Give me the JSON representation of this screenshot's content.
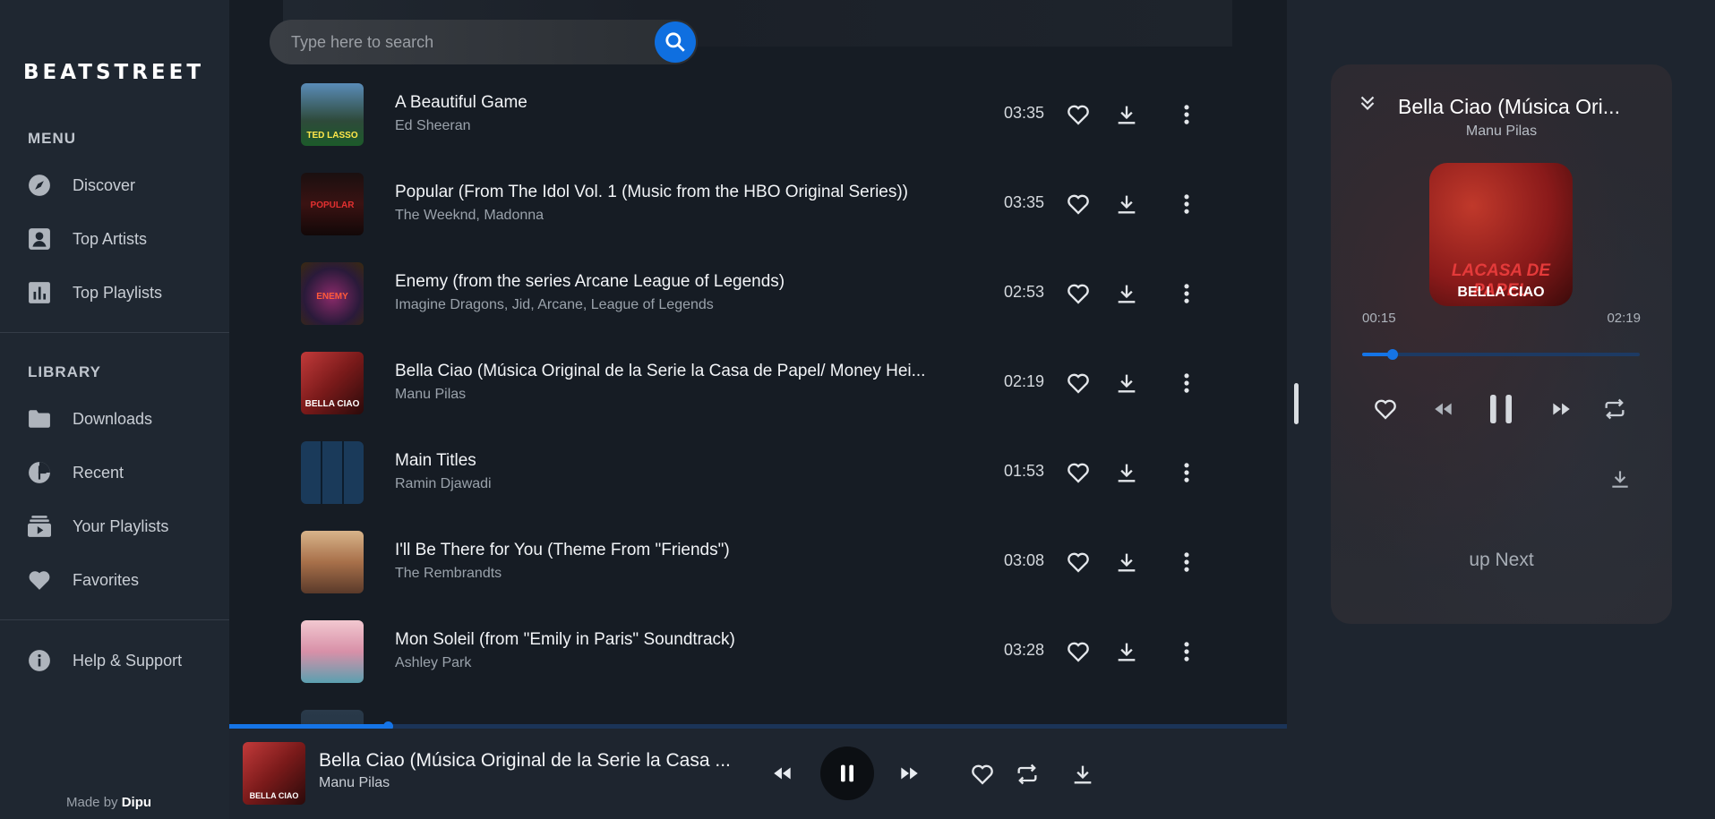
{
  "app": {
    "logo": "BEATSTREET",
    "made_by_prefix": "Made by",
    "made_by_name": "Dipu"
  },
  "sidebar": {
    "menu_title": "MENU",
    "menu": [
      {
        "label": "Discover",
        "icon": "compass-icon"
      },
      {
        "label": "Top Artists",
        "icon": "artist-icon"
      },
      {
        "label": "Top Playlists",
        "icon": "chart-icon"
      }
    ],
    "library_title": "LIBRARY",
    "library": [
      {
        "label": "Downloads",
        "icon": "folder-icon"
      },
      {
        "label": "Recent",
        "icon": "recent-icon"
      },
      {
        "label": "Your Playlists",
        "icon": "playlist-icon"
      },
      {
        "label": "Favorites",
        "icon": "heart-icon"
      }
    ],
    "help": {
      "label": "Help & Support",
      "icon": "info-icon"
    }
  },
  "search": {
    "placeholder": "Type here to search"
  },
  "songs": [
    {
      "title": "A Beautiful Game",
      "artist": "Ed Sheeran",
      "duration": "03:35"
    },
    {
      "title": "Popular (From The Idol Vol. 1 (Music from the HBO Original Series))",
      "artist": "The Weeknd, Madonna",
      "duration": "03:35"
    },
    {
      "title": "Enemy (from the series Arcane League of Legends)",
      "artist": "Imagine Dragons, Jid, Arcane, League of Legends",
      "duration": "02:53"
    },
    {
      "title": "Bella Ciao (Música Original de la Serie la Casa de Papel/ Money Hei...",
      "artist": "Manu Pilas",
      "duration": "02:19"
    },
    {
      "title": "Main Titles",
      "artist": "Ramin Djawadi",
      "duration": "01:53"
    },
    {
      "title": "I'll Be There for You (Theme From \"Friends\")",
      "artist": "The Rembrandts",
      "duration": "03:08"
    },
    {
      "title": "Mon Soleil (from \"Emily in Paris\" Soundtrack)",
      "artist": "Ashley Park",
      "duration": "03:28"
    }
  ],
  "thumb_labels": {
    "ted": "TED LASSO",
    "popular": "POPULAR",
    "enemy": "ENEMY",
    "bella": "BELLA CIAO"
  },
  "player": {
    "title": "Bella Ciao (Música Original de la Serie la Casa ...",
    "artist": "Manu Pilas",
    "progress": 0.15
  },
  "now_playing": {
    "title": "Bella Ciao (Música Ori...",
    "artist": "Manu Pilas",
    "art_caption": "BELLA CIAO",
    "art_logo": "LACASA DE PAPEL",
    "elapsed": "00:15",
    "total": "02:19",
    "progress": 0.11,
    "up_next": "up Next"
  },
  "colors": {
    "accent": "#1574e6",
    "sidebar_bg": "#1f2731",
    "list_bg": "#161c24"
  }
}
